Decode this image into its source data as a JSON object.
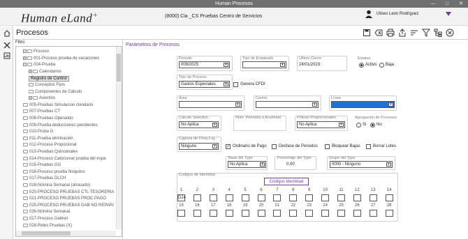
{
  "window": {
    "title": "Human Procesos",
    "minimize": "—",
    "maximize": "□",
    "close": "✕"
  },
  "header": {
    "logo": "Human eLand",
    "logo_mark": "+",
    "company": "(8000) Cia _CS  Pruebas Centro de Servicios",
    "user": "Ulises Leon Rodriguez"
  },
  "page": {
    "title": "Procesos"
  },
  "filter": {
    "label": "Filtro"
  },
  "tree": [
    {
      "label": "Proceso"
    },
    {
      "label": "001-Proceso prueba de vacaciones"
    },
    {
      "label": "004-Prueba"
    },
    {
      "label": "Calendarios"
    },
    {
      "label": "Registro de Control"
    },
    {
      "label": "Conceptos Fijos"
    },
    {
      "label": "Componentes de Cálculo"
    },
    {
      "label": "Asientos"
    },
    {
      "label": "005-Pruebas Simulacion clendario"
    },
    {
      "label": "007-Pruebas CT"
    },
    {
      "label": "008-Pruebas Operando"
    },
    {
      "label": "009-Prueba deducciones pendientes"
    },
    {
      "label": "010-Pruba G"
    },
    {
      "label": "011-Prueba eliminación"
    },
    {
      "label": "012-Proceso Propocional"
    },
    {
      "label": "013-Pruebas Quincenales"
    },
    {
      "label": "014-Proceso Catorcenal prueba del espa"
    },
    {
      "label": "015-Pruebas GG"
    },
    {
      "label": "016-Proceso prueba finiquitos"
    },
    {
      "label": "017-Pruebas DLCH"
    },
    {
      "label": "018-Nómina Semanal (atrasado)"
    },
    {
      "label": "020-PROCESO PRUEBAS CTL TESORERIA"
    },
    {
      "label": "021-PROCESO PRUEBAS PROC PAGO"
    },
    {
      "label": "025-PROCESO PRUEBAS GAB NO REPARI"
    },
    {
      "label": "026-Nómina Semanal."
    },
    {
      "label": "027-Proceso Gabriel"
    },
    {
      "label": "028-Reles Pruebas (X)"
    }
  ],
  "form": {
    "section_title": "Parámetros de Procesos",
    "periodo": {
      "label": "Periodo",
      "value": "009/2025"
    },
    "tipo_empleado": {
      "label": "Tipo de Empleado",
      "value": ""
    },
    "ultimo_cierre": {
      "label": "Ultimo Cierre",
      "value": "24/01/2023"
    },
    "estatus": {
      "label": "Estatus",
      "activo": "Activo",
      "baja": "Baja"
    },
    "tipo_proceso": {
      "label": "Tipo de Proceso",
      "value": "Gastos Especiales"
    },
    "genera_cfdi": {
      "label": "Genera CFDI"
    },
    "area": {
      "label": "Área",
      "value": ""
    },
    "centro": {
      "label": "Centro",
      "value": ""
    },
    "linea": {
      "label": "Línea",
      "value": ""
    },
    "calculo_selectivo": {
      "label": "Calculo Selectivo",
      "value": "No Aplica"
    },
    "num_periodos": {
      "label": "Núm. Periodos a Acumular",
      "value": ""
    },
    "polizas": {
      "label": "Pólizas Proporcionales",
      "value": "No Aplica"
    },
    "agrupacion": {
      "label": "Agrupación de Procesos",
      "si": "Si",
      "no": "No"
    },
    "captura_finiq": {
      "label": "Captura de Finiq./Liq.",
      "value": "Ninguno"
    },
    "checks": {
      "ordinario": "Ordinario de Pago",
      "desfase": "Desfase de Periodos",
      "bloquear": "Bloquear Bajas",
      "borrar": "Borrar Lotes"
    },
    "base_type": {
      "label": "Base del Type",
      "value": "No Aplica"
    },
    "porcentaje_type": {
      "label": "Porcentaje del Type",
      "value": "0.00"
    },
    "grupo_type": {
      "label": "Grupo del Type",
      "value": "0000 - Ninguno"
    },
    "codigos": {
      "label": "Códigos de Identidad",
      "button": "Códigos Identidad",
      "row1": [
        "1",
        "2",
        "3",
        "4",
        "5",
        "6",
        "7",
        "8",
        "9",
        "10",
        "11",
        "12",
        "13",
        "14"
      ],
      "row2": [
        "15",
        "16",
        "17",
        "18",
        "19",
        "20",
        "21",
        "22",
        "23",
        "24",
        "25",
        "26",
        "27",
        "28"
      ],
      "first_value": "D24"
    }
  },
  "colors": {
    "accent": "#6a3d9a",
    "titlebar": "#6f6f6f",
    "linea_select": "#1e73d8"
  }
}
